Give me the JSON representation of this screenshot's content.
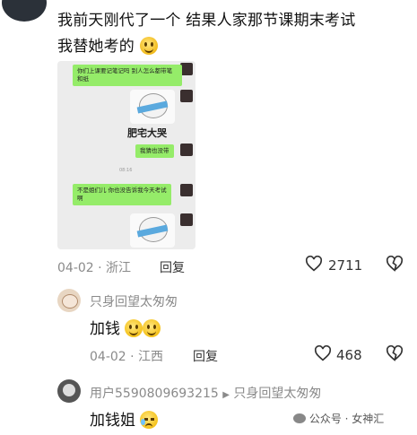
{
  "post": {
    "line1": "我前天刚代了一个  结果人家那节课期末考试",
    "line2": "我替她考的",
    "date": "04-02",
    "location": "浙江",
    "reply_label": "回复",
    "likes": "2711"
  },
  "screenshot": {
    "msg1": "你们上课要记笔记吗  别人怎么都带笔和纸",
    "sticker_caption": "肥宅大哭",
    "msg2": "我猜也没带",
    "timestamp": "08:16",
    "msg3": "不是姐们儿  你也没告诉我今天考试啊"
  },
  "comments": [
    {
      "username": "只身回望太匆匆",
      "text": "加钱",
      "date": "04-02",
      "location": "江西",
      "reply_label": "回复",
      "likes": "468"
    },
    {
      "username": "用户5590809693215",
      "reply_to": "只身回望太匆匆",
      "text": "加钱姐"
    }
  ],
  "watermark": {
    "text": "公众号 · 女神汇"
  }
}
